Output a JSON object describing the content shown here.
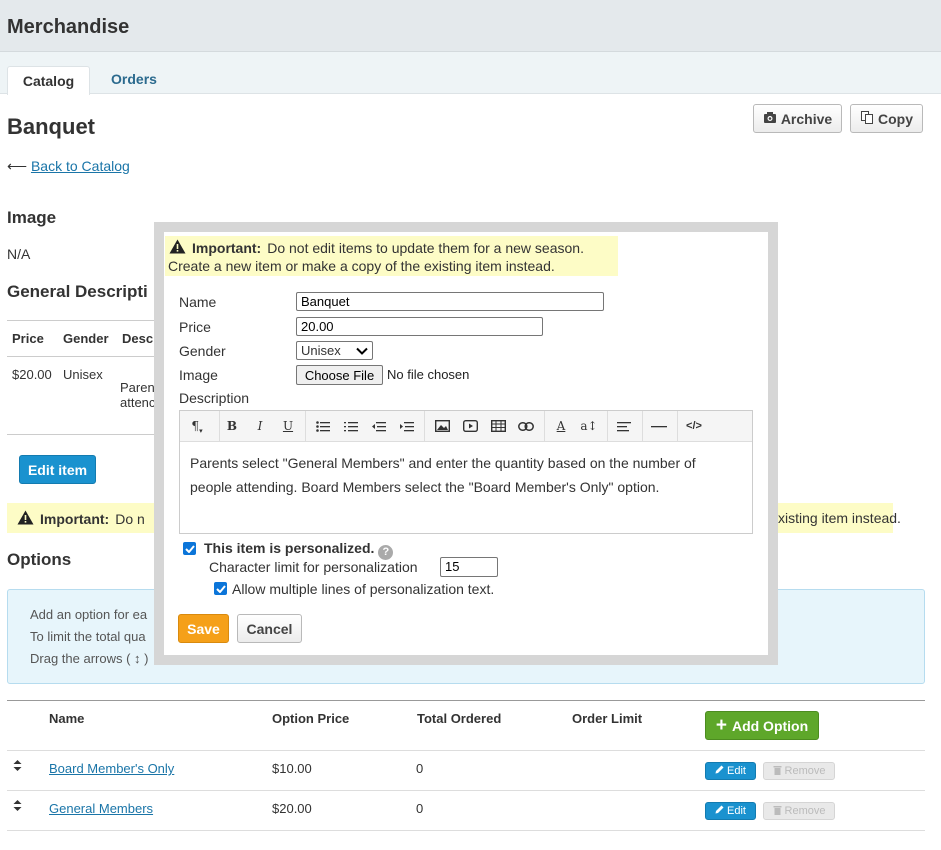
{
  "app": {
    "title": "Merchandise"
  },
  "tabs": [
    {
      "label": "Catalog"
    },
    {
      "label": "Orders"
    }
  ],
  "page": {
    "title": "Banquet",
    "archive_label": "Archive",
    "copy_label": "Copy",
    "back_arrow": "⟵",
    "back_link": "Back to Catalog",
    "image_heading": "Image",
    "image_value": "N/A",
    "description_heading": "General Descripti",
    "table": {
      "headers": [
        "Price",
        "Gender",
        "Desc"
      ],
      "row": {
        "price": "$20.00",
        "gender": "Unisex",
        "desc_line1": "Paren",
        "desc_line2": "attenc"
      }
    },
    "edit_item_label": "Edit item",
    "warning": {
      "bold": "Important:",
      "text_left": "Do n",
      "text_right": "xisting item instead."
    },
    "options_heading": "Options",
    "info_lines": [
      "Add an option for ea",
      "To limit the total qua",
      "Drag the arrows ( ↕ )"
    ]
  },
  "options": {
    "headers": {
      "name": "Name",
      "price": "Option Price",
      "total": "Total Ordered",
      "limit": "Order Limit"
    },
    "add_label": "Add Option",
    "edit_label": "Edit",
    "remove_label": "Remove",
    "rows": [
      {
        "name": "Board Member's Only",
        "price": "$10.00",
        "total": "0"
      },
      {
        "name": "General Members",
        "price": "$20.00",
        "total": "0"
      }
    ]
  },
  "modal": {
    "warning_bold": "Important:",
    "warning_line1": "Do not edit items to update them for a new season.",
    "warning_line2": "Create a new item or make a copy of the existing item instead.",
    "name_label": "Name",
    "name_value": "Banquet",
    "price_label": "Price",
    "price_value": "20.00",
    "gender_label": "Gender",
    "gender_value": "Unisex",
    "image_label": "Image",
    "choose_file_label": "Choose File",
    "no_file_text": "No file chosen",
    "description_label": "Description",
    "description_text": "Parents select \"General Members\" and enter the quantity based on the number of people attending. Board Members select the \"Board Member's Only\" option.",
    "personalized_label": "This item is personalized.",
    "personalized_checked": true,
    "char_limit_label": "Character limit for personalization",
    "char_limit_value": "15",
    "multiline_label": "Allow multiple lines of personalization text.",
    "multiline_checked": true,
    "save_label": "Save",
    "cancel_label": "Cancel"
  },
  "colors": {
    "header_bg": "#e4e9ec",
    "link": "#1a75a8",
    "primary_button": "#1a92cf",
    "add_button": "#5ea72a",
    "save_button": "#f5a019",
    "warning_bg": "#fdfcc6",
    "info_bg": "#e7f5fb"
  }
}
